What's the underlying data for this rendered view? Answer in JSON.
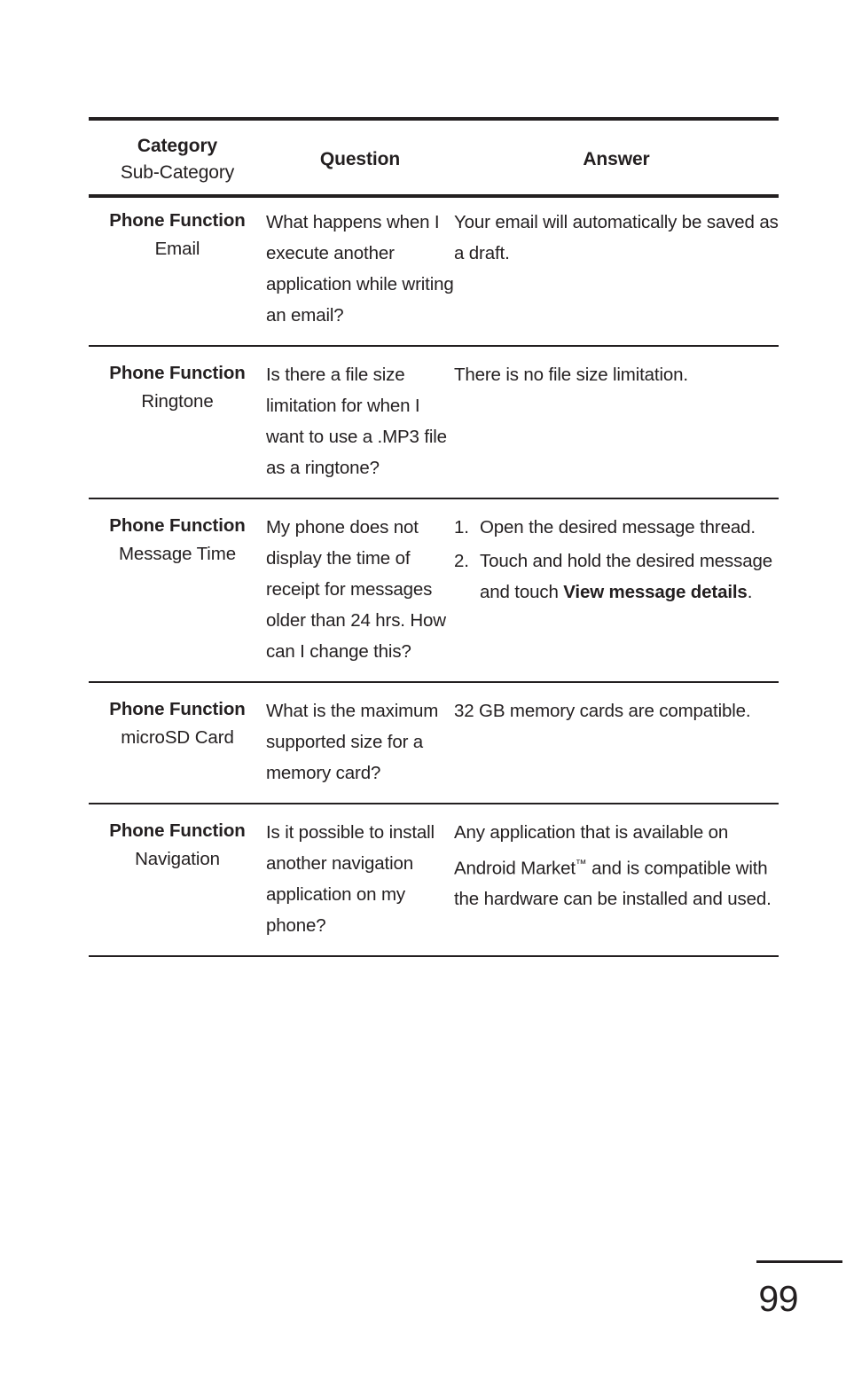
{
  "document": {
    "page_number": "99"
  },
  "table": {
    "headers": {
      "category_main": "Category",
      "category_sub": "Sub-Category",
      "question": "Question",
      "answer": "Answer"
    },
    "rows": [
      {
        "category_main": "Phone Function",
        "category_sub": "Email",
        "question": "What happens when I execute another application while writing an email?",
        "answer": "Your email will automatically be saved as a draft."
      },
      {
        "category_main": "Phone Function",
        "category_sub": "Ringtone",
        "question": "Is there a file size limitation for when I want to use a .MP3 file as a ringtone?",
        "answer": "There is no file size limitation."
      },
      {
        "category_main": "Phone Function",
        "category_sub": "Message Time",
        "question": "My phone does not display the time of receipt for messages older than 24 hrs. How can I change this?",
        "answer_steps": [
          {
            "number": "1.",
            "text": "Open the desired message thread."
          },
          {
            "number": "2.",
            "text_before": "Touch and hold the desired message and touch ",
            "text_bold": "View message details",
            "text_after": "."
          }
        ]
      },
      {
        "category_main": "Phone Function",
        "category_sub": "microSD Card",
        "question": "What is the maximum supported size for a memory card?",
        "answer": "32 GB memory cards are compatible."
      },
      {
        "category_main": "Phone Function",
        "category_sub": "Navigation",
        "question": "Is it possible to install another navigation application on my phone?",
        "answer_before_tm": "Any application that is available on Android Market",
        "answer_tm": "™",
        "answer_after_tm": " and is compatible with the hardware can be installed and used."
      }
    ]
  }
}
